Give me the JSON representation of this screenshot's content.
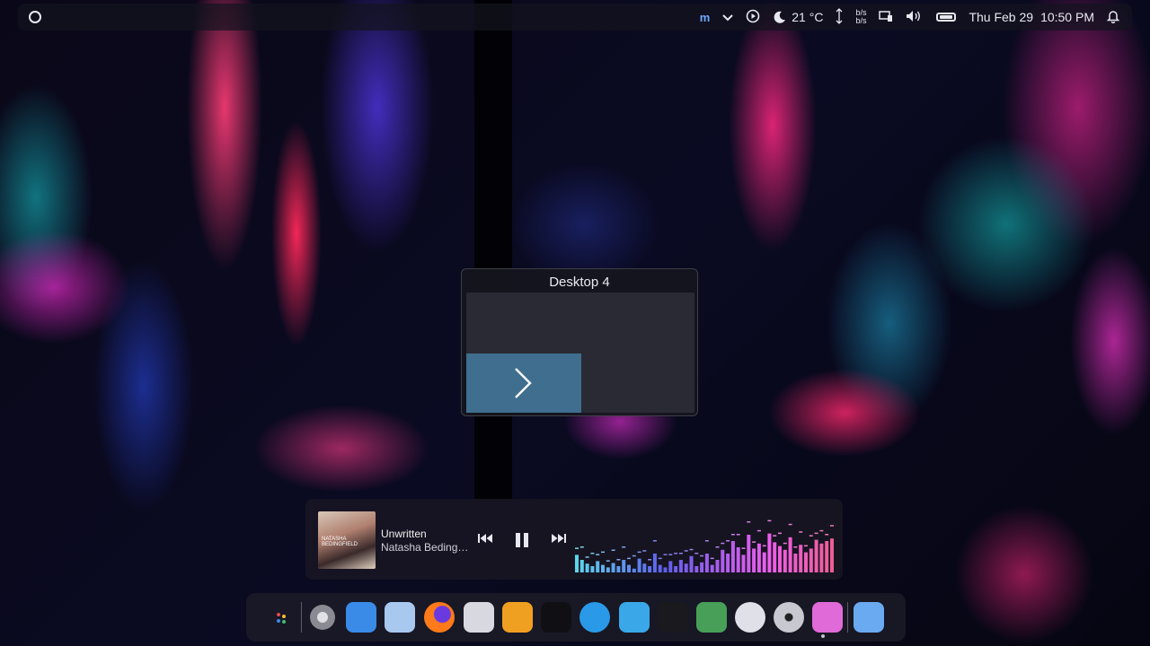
{
  "panel": {
    "temperature": "21 °C",
    "net_up": "b/s",
    "net_down": "b/s",
    "date": "Thu Feb 29",
    "time": "10:50 PM"
  },
  "switcher": {
    "title": "Desktop 4"
  },
  "player": {
    "song": "Unwritten",
    "artist": "Natasha Beding…",
    "cover_text": "NATASHA BEDINGFIELD",
    "visualizer_levels": [
      0.28,
      0.2,
      0.14,
      0.1,
      0.18,
      0.12,
      0.08,
      0.15,
      0.1,
      0.2,
      0.12,
      0.06,
      0.22,
      0.14,
      0.1,
      0.3,
      0.12,
      0.08,
      0.18,
      0.1,
      0.2,
      0.14,
      0.26,
      0.1,
      0.16,
      0.3,
      0.12,
      0.2,
      0.36,
      0.3,
      0.5,
      0.4,
      0.28,
      0.6,
      0.38,
      0.46,
      0.32,
      0.62,
      0.48,
      0.42,
      0.36,
      0.56,
      0.3,
      0.44,
      0.32,
      0.38,
      0.52,
      0.46,
      0.5,
      0.54
    ]
  },
  "dock": {
    "items": [
      {
        "name": "launcher-icon",
        "color": "#2a2a3a"
      },
      {
        "name": "settings-icon",
        "color": "#8a8a92"
      },
      {
        "name": "files-icon",
        "color": "#3a8ae8"
      },
      {
        "name": "bag-icon",
        "color": "#a8c8f0"
      },
      {
        "name": "firefox-icon",
        "color": "#ff7a1a"
      },
      {
        "name": "text-editor-icon",
        "color": "#d8d8e0"
      },
      {
        "name": "layers-icon",
        "color": "#f0a020"
      },
      {
        "name": "app-a-icon",
        "color": "#101014"
      },
      {
        "name": "chat-icon",
        "color": "#2a9ae8"
      },
      {
        "name": "telegram-icon",
        "color": "#3aa8e8"
      },
      {
        "name": "m-app-icon",
        "color": "#1a1a1e"
      },
      {
        "name": "folder-icon",
        "color": "#48a058"
      },
      {
        "name": "search-app-icon",
        "color": "#e0e0e8"
      },
      {
        "name": "disc-icon",
        "color": "#c8c8d0"
      },
      {
        "name": "crop-app-icon",
        "color": "#e06ad8"
      },
      {
        "name": "music-app-icon",
        "color": "#6aaaf0"
      }
    ]
  }
}
